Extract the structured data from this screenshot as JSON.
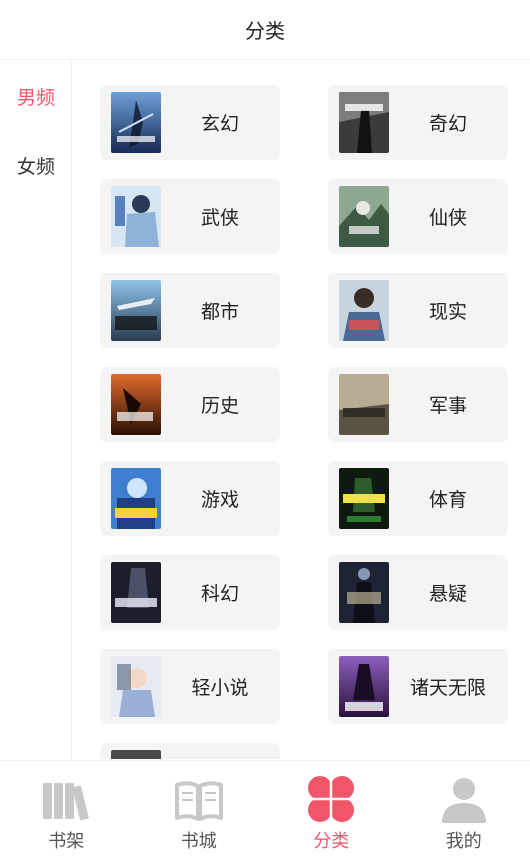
{
  "header": {
    "title": "分类"
  },
  "sidebar": {
    "items": [
      {
        "label": "男频",
        "active": true
      },
      {
        "label": "女频",
        "active": false
      }
    ]
  },
  "categories": [
    {
      "label": "玄幻",
      "cover": "blue-warrior-cover"
    },
    {
      "label": "奇幻",
      "cover": "dark-figure-cover"
    },
    {
      "label": "武侠",
      "cover": "white-swordsman-cover"
    },
    {
      "label": "仙侠",
      "cover": "green-mountain-cover"
    },
    {
      "label": "都市",
      "cover": "sky-city-cover"
    },
    {
      "label": "现实",
      "cover": "portrait-man-cover"
    },
    {
      "label": "历史",
      "cover": "fire-battle-cover"
    },
    {
      "label": "军事",
      "cover": "sepia-military-cover"
    },
    {
      "label": "游戏",
      "cover": "blue-anime-cover"
    },
    {
      "label": "体育",
      "cover": "green-sports-cover"
    },
    {
      "label": "科幻",
      "cover": "dark-scifi-cover"
    },
    {
      "label": "悬疑",
      "cover": "night-mystery-cover"
    },
    {
      "label": "轻小说",
      "cover": "light-novel-cover"
    },
    {
      "label": "诸天无限",
      "cover": "purple-infinite-cover"
    }
  ],
  "tabbar": {
    "items": [
      {
        "label": "书架",
        "icon": "bookshelf-icon",
        "active": false
      },
      {
        "label": "书城",
        "icon": "open-book-icon",
        "active": false
      },
      {
        "label": "分类",
        "icon": "category-petals-icon",
        "active": true
      },
      {
        "label": "我的",
        "icon": "user-icon",
        "active": false
      }
    ]
  },
  "colors": {
    "accent": "#f2556a",
    "card_bg": "#f4f4f4",
    "inactive_icon": "#c8c8c8"
  }
}
